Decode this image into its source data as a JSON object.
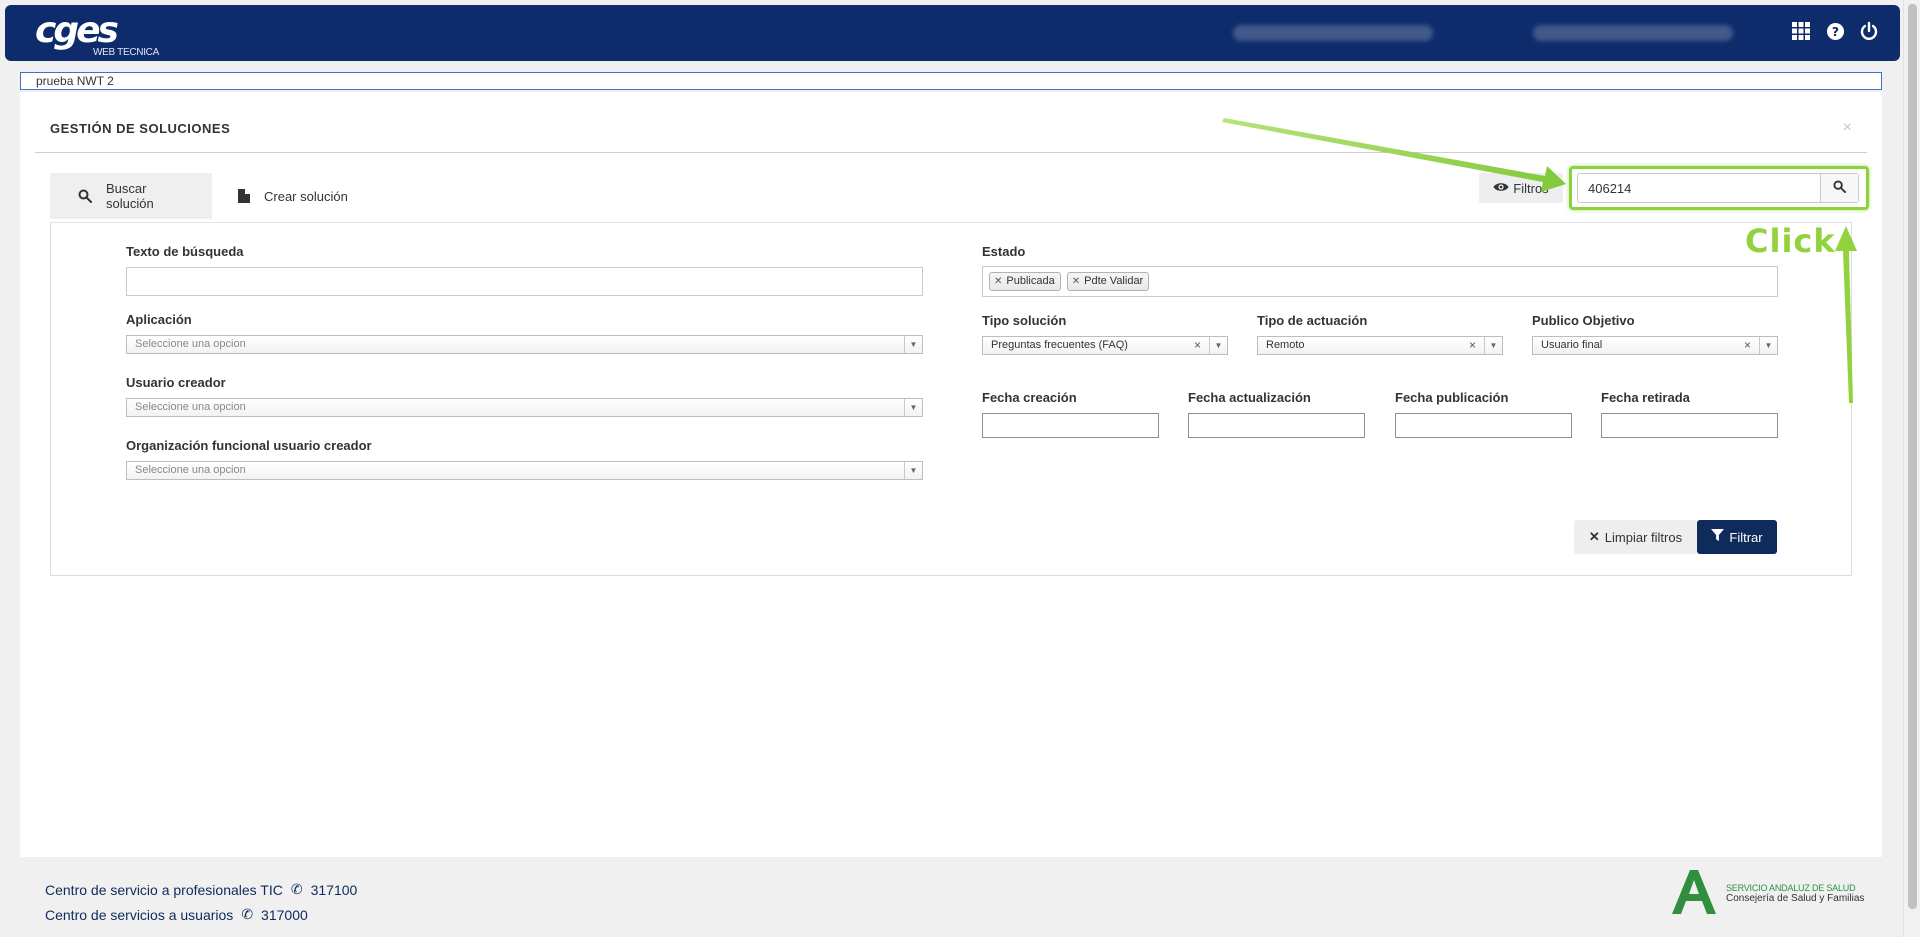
{
  "header": {
    "logo_text": "cges",
    "logo_subtext": "WEB TECNICA",
    "icons": [
      "apps-grid-icon",
      "help-icon",
      "power-icon"
    ]
  },
  "breadcrumb": {
    "value": "prueba NWT 2"
  },
  "panel": {
    "title": "GESTIÓN DE SOLUCIONES",
    "close": "×"
  },
  "tabs": [
    {
      "label": "Buscar solución",
      "icon": "search-icon"
    },
    {
      "label": "Crear solución",
      "icon": "file-icon"
    }
  ],
  "toolbar": {
    "filters_label": "Filtros",
    "search_value": "406214"
  },
  "form": {
    "texto_busqueda_label": "Texto de búsqueda",
    "texto_busqueda_value": "",
    "aplicacion_label": "Aplicación",
    "aplicacion_placeholder": "Seleccione una opcion",
    "usuario_creador_label": "Usuario creador",
    "usuario_creador_placeholder": "Seleccione una opcion",
    "organizacion_label": "Organización funcional usuario creador",
    "organizacion_placeholder": "Seleccione una opcion",
    "estado_label": "Estado",
    "estado_tags": [
      "Publicada",
      "Pdte Validar"
    ],
    "tipo_solucion_label": "Tipo solución",
    "tipo_solucion_value": "Preguntas frecuentes (FAQ)",
    "tipo_actuacion_label": "Tipo de actuación",
    "tipo_actuacion_value": "Remoto",
    "publico_objetivo_label": "Publico Objetivo",
    "publico_objetivo_value": "Usuario final",
    "fecha_creacion_label": "Fecha creación",
    "fecha_actualizacion_label": "Fecha actualización",
    "fecha_publicacion_label": "Fecha publicación",
    "fecha_retirada_label": "Fecha retirada"
  },
  "actions": {
    "clear_label": "Limpiar filtros",
    "filter_label": "Filtrar"
  },
  "annotation": {
    "click_label": "Click"
  },
  "footer": {
    "line1_text": "Centro de servicio a profesionales TIC",
    "line1_phone": "317100",
    "line2_text": "Centro de servicios a usuarios",
    "line2_phone": "317000",
    "logo_line1": "SERVICIO ANDALUZ DE SALUD",
    "logo_line2": "Consejería de Salud y Familias"
  },
  "colors": {
    "header_bg": "#0e2b6b",
    "accent_annotation": "#8cd23c",
    "filter_button": "#0e2b5c"
  }
}
